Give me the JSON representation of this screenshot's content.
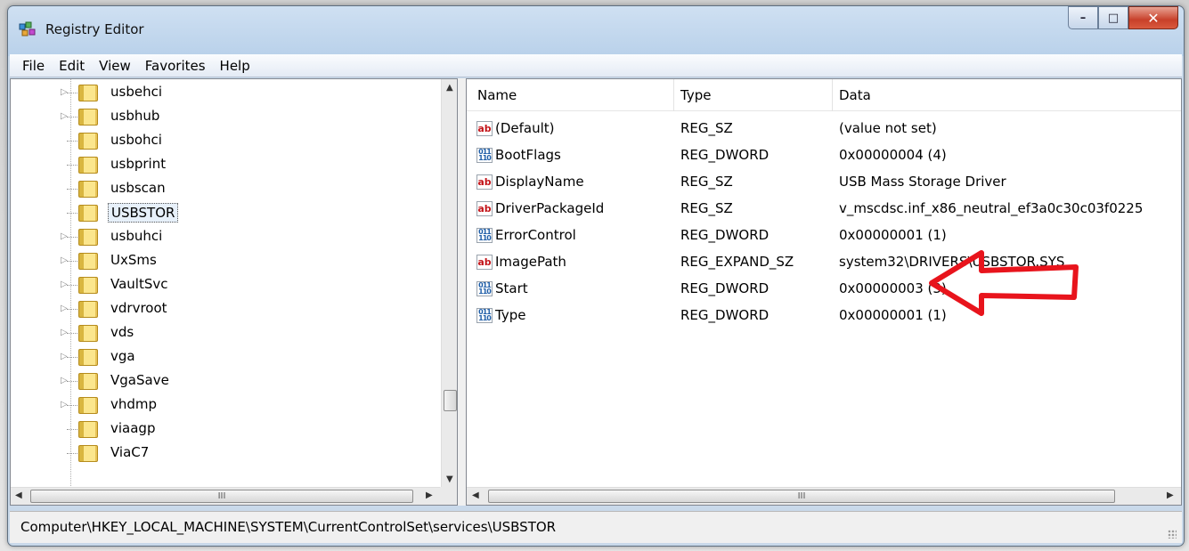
{
  "window": {
    "title": "Registry Editor",
    "controls": {
      "minimize": "–",
      "maximize": "□",
      "close": "✕"
    }
  },
  "menu": [
    "File",
    "Edit",
    "View",
    "Favorites",
    "Help"
  ],
  "tree": {
    "items": [
      {
        "label": "usbehci",
        "expandable": true
      },
      {
        "label": "usbhub",
        "expandable": true
      },
      {
        "label": "usbohci",
        "expandable": false
      },
      {
        "label": "usbprint",
        "expandable": false
      },
      {
        "label": "usbscan",
        "expandable": false
      },
      {
        "label": "USBSTOR",
        "expandable": false,
        "selected": true
      },
      {
        "label": "usbuhci",
        "expandable": true
      },
      {
        "label": "UxSms",
        "expandable": true
      },
      {
        "label": "VaultSvc",
        "expandable": true
      },
      {
        "label": "vdrvroot",
        "expandable": true
      },
      {
        "label": "vds",
        "expandable": true
      },
      {
        "label": "vga",
        "expandable": true
      },
      {
        "label": "VgaSave",
        "expandable": true
      },
      {
        "label": "vhdmp",
        "expandable": true
      },
      {
        "label": "viaagp",
        "expandable": false
      },
      {
        "label": "ViaC7",
        "expandable": false
      }
    ],
    "scroll_label": "III"
  },
  "list": {
    "columns": [
      "Name",
      "Type",
      "Data"
    ],
    "rows": [
      {
        "icon": "string-value-icon",
        "icon_text": "ab",
        "name": "(Default)",
        "type": "REG_SZ",
        "data": "(value not set)"
      },
      {
        "icon": "dword-value-icon",
        "icon_text": "011\n110",
        "name": "BootFlags",
        "type": "REG_DWORD",
        "data": "0x00000004 (4)"
      },
      {
        "icon": "string-value-icon",
        "icon_text": "ab",
        "name": "DisplayName",
        "type": "REG_SZ",
        "data": "USB Mass Storage Driver"
      },
      {
        "icon": "string-value-icon",
        "icon_text": "ab",
        "name": "DriverPackageId",
        "type": "REG_SZ",
        "data": "v_mscdsc.inf_x86_neutral_ef3a0c30c03f0225"
      },
      {
        "icon": "dword-value-icon",
        "icon_text": "011\n110",
        "name": "ErrorControl",
        "type": "REG_DWORD",
        "data": "0x00000001 (1)"
      },
      {
        "icon": "string-value-icon",
        "icon_text": "ab",
        "name": "ImagePath",
        "type": "REG_EXPAND_SZ",
        "data": "system32\\DRIVERS\\USBSTOR.SYS"
      },
      {
        "icon": "dword-value-icon",
        "icon_text": "011\n110",
        "name": "Start",
        "type": "REG_DWORD",
        "data": "0x00000003 (3)"
      },
      {
        "icon": "dword-value-icon",
        "icon_text": "011\n110",
        "name": "Type",
        "type": "REG_DWORD",
        "data": "0x00000001 (1)"
      }
    ],
    "scroll_label": "III"
  },
  "status": {
    "path": "Computer\\HKEY_LOCAL_MACHINE\\SYSTEM\\CurrentControlSet\\services\\USBSTOR"
  },
  "colors": {
    "annotation_arrow": "#e8141c",
    "selection": "#e7f0fa"
  }
}
